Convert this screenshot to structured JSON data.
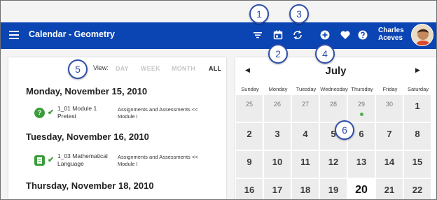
{
  "header": {
    "title": "Calendar - Geometry",
    "user_first": "Charles",
    "user_last": "Aceves"
  },
  "callouts": [
    "1",
    "2",
    "3",
    "4",
    "5",
    "6"
  ],
  "view": {
    "label": "View:",
    "options": [
      "DAY",
      "WEEK",
      "MONTH",
      "ALL"
    ],
    "active": "ALL"
  },
  "agenda": [
    {
      "date": "Monday, November 15, 2010",
      "items": [
        {
          "icon": "question-icon",
          "title": "1_01 Module 1 Pretest",
          "desc": "Assignments and Assessments << Module I"
        }
      ]
    },
    {
      "date": "Tuesday, November 16, 2010",
      "items": [
        {
          "icon": "document-icon",
          "title": "1_03 Mathematical Language",
          "desc": "Assignments and Assessments << Module I"
        }
      ]
    },
    {
      "date": "Thursday, November 18, 2010",
      "items": []
    }
  ],
  "calendar": {
    "month": "July",
    "prev": "◀",
    "next": "▶",
    "weekdays": [
      "Sunday",
      "Monday",
      "Tuesday",
      "Wednesday",
      "Thursday",
      "Friday",
      "Saturday"
    ],
    "row1": [
      "25",
      "26",
      "27",
      "28",
      "29",
      "30",
      "1"
    ],
    "row2": [
      "2",
      "3",
      "4",
      "5",
      "6",
      "7",
      "8"
    ],
    "row3": [
      "9",
      "10",
      "11",
      "12",
      "13",
      "14",
      "15"
    ],
    "row4": [
      "16",
      "17",
      "18",
      "19",
      "20",
      "21",
      "22"
    ],
    "today": "20"
  },
  "colors": {
    "header_bg": "#0b45b3",
    "success": "#3a9c3a",
    "callout": "#2f4faa"
  }
}
